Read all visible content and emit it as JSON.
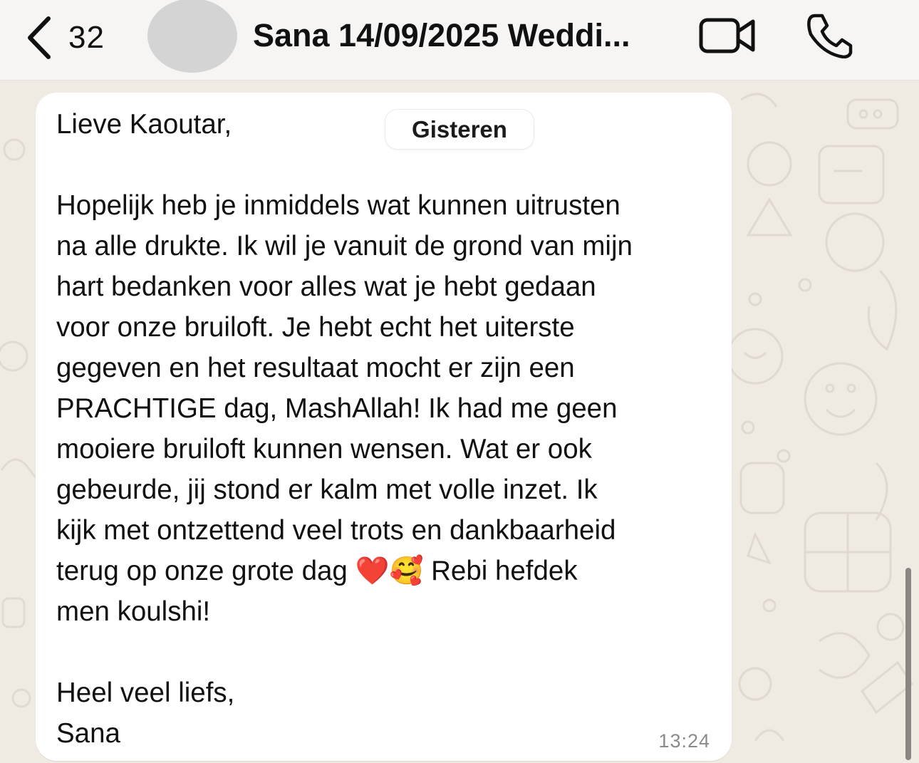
{
  "header": {
    "back_count": "32",
    "title": "Sana 14/09/2025 Weddi..."
  },
  "date_separator": "Gisteren",
  "message": {
    "text": "Lieve Kaoutar,\n\nHopelijk heb je inmiddels wat kunnen uitrusten\nna alle drukte. Ik wil je vanuit de grond van mijn\nhart bedanken voor alles wat je hebt gedaan\nvoor onze bruiloft. Je hebt echt het uiterste\ngegeven en het resultaat mocht er zijn een\nPRACHTIGE dag, MashAllah! Ik had me geen\nmooiere bruiloft kunnen wensen. Wat er ook\ngebeurde, jij stond er kalm met volle inzet. Ik\nkijk met ontzettend veel trots en dankbaarheid\nterug op onze grote dag ❤️🥰 Rebi hefdek\nmen koulshi!\n\nHeel veel liefs,\nSana",
    "time": "13:24"
  },
  "icons": {
    "back": "chevron-left-icon",
    "video": "video-camera-icon",
    "call": "phone-icon"
  },
  "colors": {
    "header_bg": "#f6f5f3",
    "chat_bg": "#efeae2",
    "bubble_bg": "#ffffff",
    "avatar_placeholder": "#d4d4d4"
  }
}
